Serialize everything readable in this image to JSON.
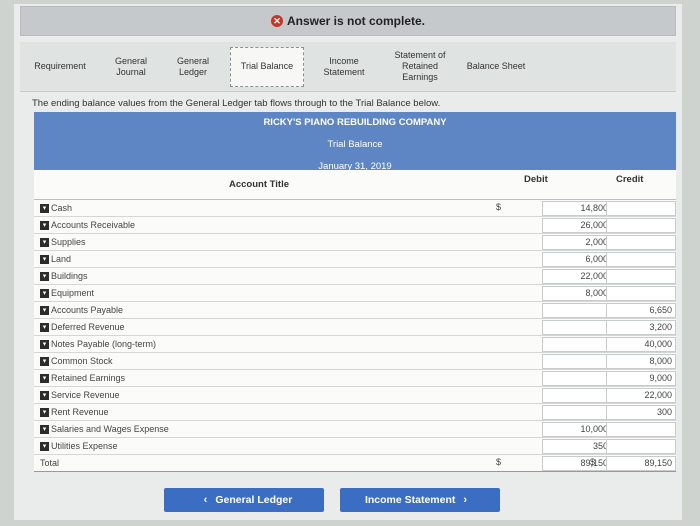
{
  "banner": {
    "text": "Answer is not complete.",
    "icon": "error-x-icon"
  },
  "tabs": [
    {
      "label": "Requirement",
      "active": false
    },
    {
      "label": "General\nJournal",
      "active": false
    },
    {
      "label": "General\nLedger",
      "active": false
    },
    {
      "label": "Trial Balance",
      "active": true
    },
    {
      "label": "Income\nStatement",
      "active": false
    },
    {
      "label": "Statement of\nRetained\nEarnings",
      "active": false
    },
    {
      "label": "Balance Sheet",
      "active": false
    }
  ],
  "note": "The ending balance values from the General Ledger tab flows through to the Trial Balance below.",
  "header": {
    "company": "RICKY'S PIANO REBUILDING COMPANY",
    "report": "Trial Balance",
    "date": "January 31, 2019"
  },
  "columns": {
    "account": "Account Title",
    "debit": "Debit",
    "credit": "Credit"
  },
  "rows": [
    {
      "account": "Cash",
      "debit": "14,800",
      "credit": "",
      "debit_dollar": "$"
    },
    {
      "account": "Accounts Receivable",
      "debit": "26,000",
      "credit": ""
    },
    {
      "account": "Supplies",
      "debit": "2,000",
      "credit": ""
    },
    {
      "account": "Land",
      "debit": "6,000",
      "credit": ""
    },
    {
      "account": "Buildings",
      "debit": "22,000",
      "credit": ""
    },
    {
      "account": "Equipment",
      "debit": "8,000",
      "credit": ""
    },
    {
      "account": "Accounts Payable",
      "debit": "",
      "credit": "6,650"
    },
    {
      "account": "Deferred Revenue",
      "debit": "",
      "credit": "3,200"
    },
    {
      "account": "Notes Payable (long-term)",
      "debit": "",
      "credit": "40,000"
    },
    {
      "account": "Common Stock",
      "debit": "",
      "credit": "8,000"
    },
    {
      "account": "Retained Earnings",
      "debit": "",
      "credit": "9,000"
    },
    {
      "account": "Service Revenue",
      "debit": "",
      "credit": "22,000"
    },
    {
      "account": "Rent Revenue",
      "debit": "",
      "credit": "300"
    },
    {
      "account": "Salaries and Wages Expense",
      "debit": "10,000",
      "credit": ""
    },
    {
      "account": "Utilities Expense",
      "debit": "350",
      "credit": ""
    }
  ],
  "total": {
    "label": "Total",
    "debit": "89,150",
    "credit": "89,150",
    "currency": "$"
  },
  "buttons": {
    "prev": "General Ledger",
    "next": "Income Statement"
  }
}
